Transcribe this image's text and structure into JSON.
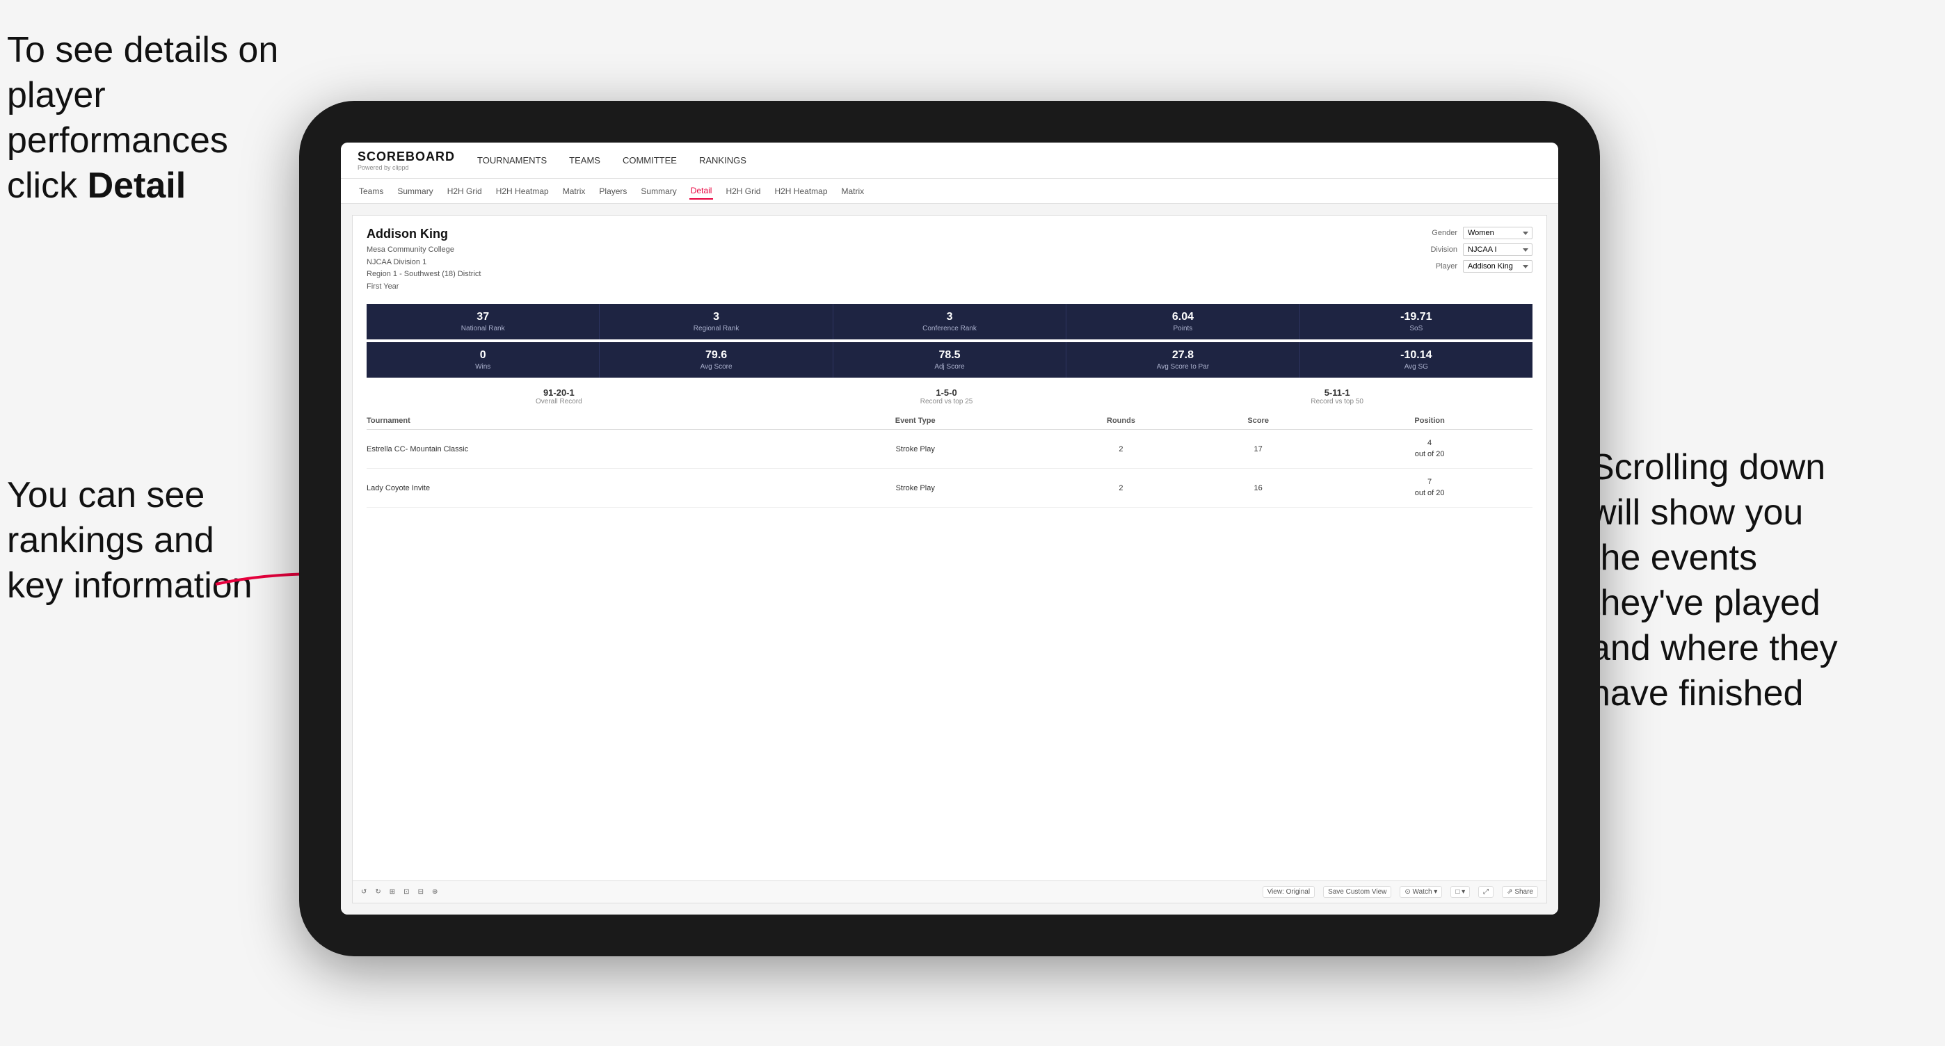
{
  "annotations": {
    "top_left": "To see details on player performances click ",
    "top_left_bold": "Detail",
    "bottom_left_line1": "You can see",
    "bottom_left_line2": "rankings and",
    "bottom_left_line3": "key information",
    "right_line1": "Scrolling down",
    "right_line2": "will show you",
    "right_line3": "the events",
    "right_line4": "they've played",
    "right_line5": "and where they",
    "right_line6": "have finished"
  },
  "nav": {
    "logo": "SCOREBOARD",
    "logo_sub": "Powered by clippd",
    "items": [
      "TOURNAMENTS",
      "TEAMS",
      "COMMITTEE",
      "RANKINGS"
    ]
  },
  "subnav": {
    "items": [
      "Teams",
      "Summary",
      "H2H Grid",
      "H2H Heatmap",
      "Matrix",
      "Players",
      "Summary",
      "Detail",
      "H2H Grid",
      "H2H Heatmap",
      "Matrix"
    ],
    "active": "Detail"
  },
  "player": {
    "name": "Addison King",
    "school": "Mesa Community College",
    "division": "NJCAA Division 1",
    "region": "Region 1 - Southwest (18) District",
    "year": "First Year"
  },
  "filters": {
    "gender_label": "Gender",
    "gender_value": "Women",
    "division_label": "Division",
    "division_value": "NJCAA I",
    "player_label": "Player",
    "player_value": "Addison King"
  },
  "stats_row1": [
    {
      "value": "37",
      "label": "National Rank"
    },
    {
      "value": "3",
      "label": "Regional Rank"
    },
    {
      "value": "3",
      "label": "Conference Rank"
    },
    {
      "value": "6.04",
      "label": "Points"
    },
    {
      "value": "-19.71",
      "label": "SoS"
    }
  ],
  "stats_row2": [
    {
      "value": "0",
      "label": "Wins"
    },
    {
      "value": "79.6",
      "label": "Avg Score"
    },
    {
      "value": "78.5",
      "label": "Adj Score"
    },
    {
      "value": "27.8",
      "label": "Avg Score to Par"
    },
    {
      "value": "-10.14",
      "label": "Avg SG"
    }
  ],
  "records": [
    {
      "value": "91-20-1",
      "label": "Overall Record"
    },
    {
      "value": "1-5-0",
      "label": "Record vs top 25"
    },
    {
      "value": "5-11-1",
      "label": "Record vs top 50"
    }
  ],
  "table": {
    "headers": [
      "Tournament",
      "Event Type",
      "Rounds",
      "Score",
      "Position"
    ],
    "rows": [
      {
        "tournament": "Estrella CC- Mountain Classic",
        "event_type": "Stroke Play",
        "rounds": "2",
        "score": "17",
        "position": "4\nout of 20"
      },
      {
        "tournament": "Lady Coyote Invite",
        "event_type": "Stroke Play",
        "rounds": "2",
        "score": "16",
        "position": "7\nout of 20"
      }
    ]
  },
  "toolbar": {
    "buttons": [
      "↺",
      "↻",
      "⊞",
      "⊡",
      "⊟ -",
      "⊕",
      "View: Original",
      "Save Custom View",
      "Watch ▾",
      "□ ▾",
      "⤢",
      "Share"
    ]
  }
}
